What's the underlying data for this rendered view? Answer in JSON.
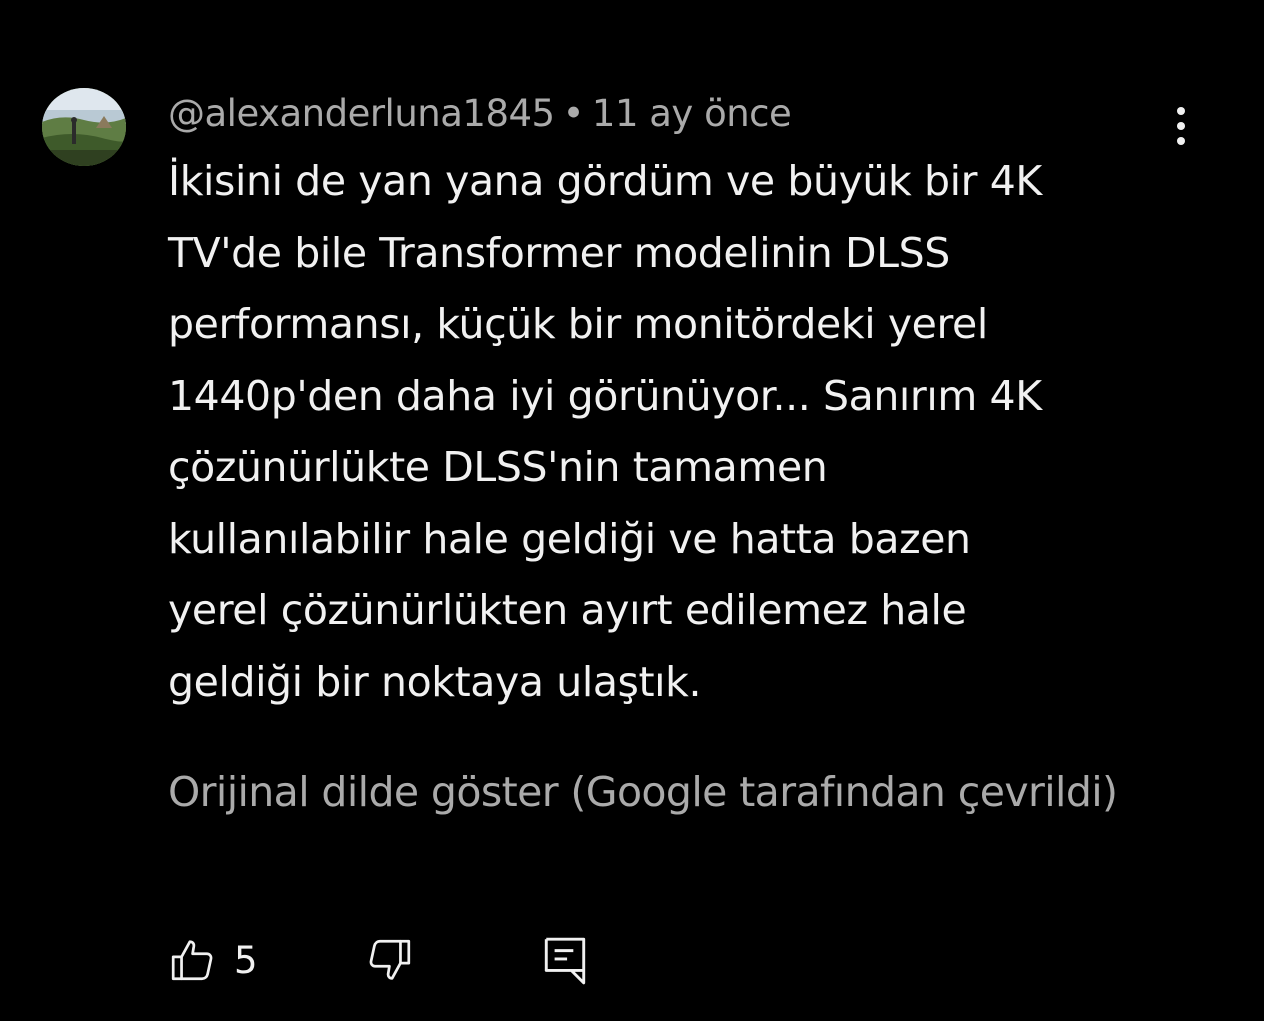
{
  "comment": {
    "author": "@alexanderluna1845",
    "separator": "•",
    "timestamp": "11 ay önce",
    "text_lines": [
      "İkisini de yan yana gördüm ve büyük bir 4K",
      "TV'de bile Transformer modelinin DLSS",
      "performansı, küçük bir monitördeki yerel",
      "1440p'den daha iyi görünüyor... Sanırım 4K",
      "çözünürlükte DLSS'nin tamamen",
      "kullanılabilir hale geldiği ve hatta bazen",
      "yerel çözünürlükten ayırt edilemez hale",
      "geldiği bir noktaya ulaştık."
    ],
    "translate_link": "Orijinal dilde göster (Google tarafından çevrildi)",
    "like_count": "5"
  },
  "icons": {
    "avatar": "avatar-landscape-photo",
    "more": "more-vert-icon",
    "like": "thumbs-up-icon",
    "dislike": "thumbs-down-icon",
    "reply": "reply-comment-icon"
  },
  "colors": {
    "background": "#000000",
    "primary_text": "#f1f1f1",
    "secondary_text": "#aaaaaa"
  }
}
